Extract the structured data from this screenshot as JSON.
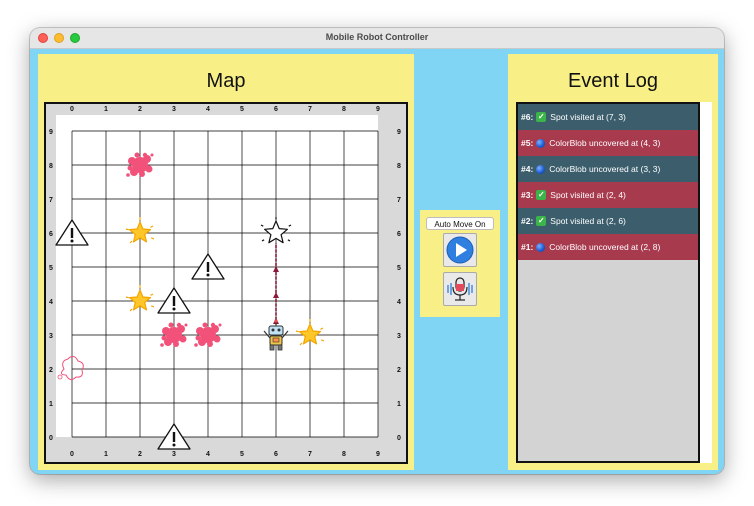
{
  "window": {
    "title": "Mobile Robot Controller"
  },
  "map": {
    "title": "Map",
    "x_ticks": [
      "0",
      "1",
      "2",
      "3",
      "4",
      "5",
      "6",
      "7",
      "8",
      "9"
    ],
    "y_ticks": [
      "9",
      "8",
      "7",
      "6",
      "5",
      "4",
      "3",
      "2",
      "1",
      "0"
    ],
    "objects": [
      {
        "type": "colorblob",
        "x": 2,
        "y": 8,
        "icon": "paint-splat-icon"
      },
      {
        "type": "spot",
        "x": 2,
        "y": 6,
        "icon": "star-icon"
      },
      {
        "type": "spot",
        "x": 2,
        "y": 4,
        "icon": "star-icon"
      },
      {
        "type": "colorblob",
        "x": 3,
        "y": 3,
        "icon": "paint-splat-icon"
      },
      {
        "type": "colorblob",
        "x": 4,
        "y": 3,
        "icon": "paint-splat-icon"
      },
      {
        "type": "spot",
        "x": 7,
        "y": 3,
        "icon": "star-icon"
      },
      {
        "type": "hazard",
        "x": 0,
        "y": 6,
        "icon": "warning-icon"
      },
      {
        "type": "hazard",
        "x": 4,
        "y": 5,
        "icon": "warning-icon"
      },
      {
        "type": "hazard",
        "x": 3,
        "y": 4,
        "icon": "warning-icon"
      },
      {
        "type": "hazard",
        "x": 3,
        "y": 0,
        "icon": "warning-icon"
      },
      {
        "type": "hidden-blob",
        "x": 0,
        "y": 2,
        "icon": "splat-outline-icon"
      },
      {
        "type": "target",
        "x": 6,
        "y": 6,
        "icon": "target-star-icon"
      },
      {
        "type": "robot",
        "x": 6,
        "y": 3,
        "icon": "robot-icon"
      }
    ],
    "path": [
      [
        6,
        3
      ],
      [
        6,
        6
      ]
    ],
    "colors": {
      "grid": "#000000",
      "path": "#8b1a3a",
      "star": "#ffc629",
      "blob": "#f2527a"
    }
  },
  "controls": {
    "auto_move_label": "Auto Move On",
    "play_icon": "play-icon",
    "mic_icon": "microphone-icon"
  },
  "event_log": {
    "title": "Event Log",
    "entries": [
      {
        "num": "#6:",
        "icon": "check",
        "text": "Spot visited at (7, 3)",
        "color": "#3c5e6c"
      },
      {
        "num": "#5:",
        "icon": "dot",
        "text": "ColorBlob uncovered at (4, 3)",
        "color": "#a83a4e"
      },
      {
        "num": "#4:",
        "icon": "dot",
        "text": "ColorBlob uncovered at (3, 3)",
        "color": "#3c5e6c"
      },
      {
        "num": "#3:",
        "icon": "check",
        "text": "Spot visited at (2, 4)",
        "color": "#a83a4e"
      },
      {
        "num": "#2:",
        "icon": "check",
        "text": "Spot visited at (2, 6)",
        "color": "#3c5e6c"
      },
      {
        "num": "#1:",
        "icon": "dot",
        "text": "ColorBlob uncovered at (2, 8)",
        "color": "#a83a4e"
      }
    ]
  }
}
